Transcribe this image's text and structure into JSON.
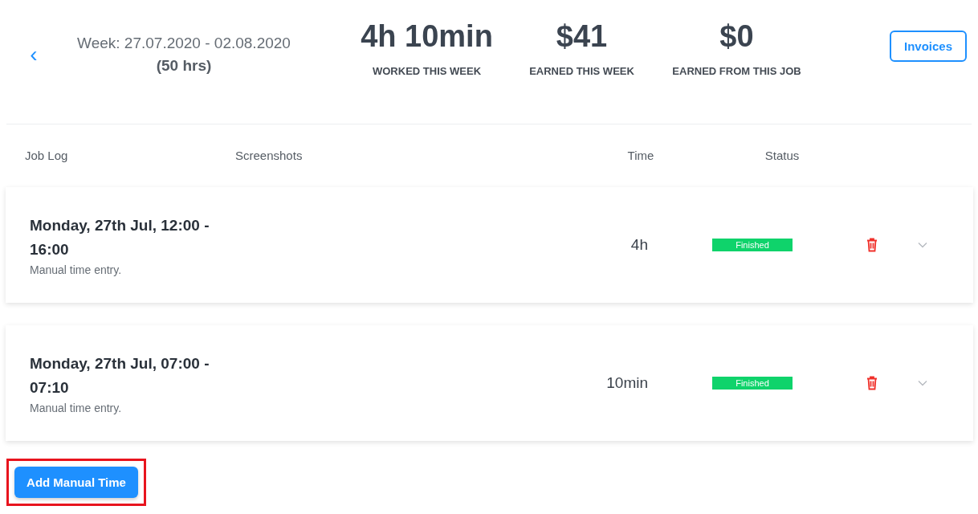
{
  "header": {
    "back_label": "‹",
    "week": "Week: 27.07.2020 - 02.08.2020",
    "total_hours": "(50 hrs)"
  },
  "stats": [
    {
      "value": "4h 10min",
      "label": "WORKED THIS WEEK"
    },
    {
      "value": "$41",
      "label": "EARNED THIS WEEK"
    },
    {
      "value": "$0",
      "label": "EARNED FROM THIS JOB"
    }
  ],
  "invoices_button": "Invoices",
  "columns": [
    "Job Log",
    "Screenshots",
    "Time",
    "Status"
  ],
  "entries": [
    {
      "title": "Monday, 27th Jul, 12:00 - 16:00",
      "note": "Manual time entry.",
      "time": "4h",
      "status": "Finished",
      "expanded": false
    },
    {
      "title": "Monday, 27th Jul, 07:00 - 07:10",
      "note": "Manual time entry.",
      "time": "10min",
      "status": "Finished",
      "expanded": false
    }
  ],
  "add_button": {
    "label": "Add Manual Time",
    "highlighted": true
  }
}
